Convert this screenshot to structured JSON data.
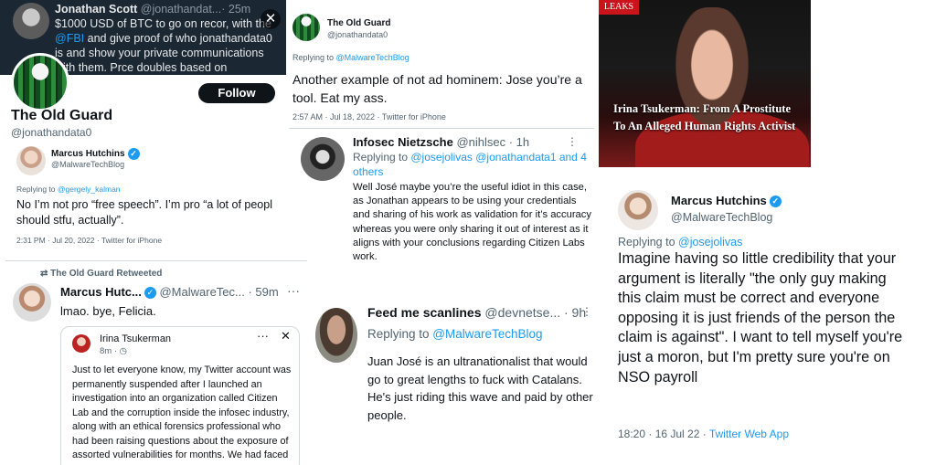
{
  "panel1": {
    "dark_tweet": {
      "author": "Jonathan Scott",
      "handle_time": "@jonathandat...· 25m",
      "text_part1": "$1000 USD of BTC to go on recor, with the ",
      "mention": "@FBI",
      "text_part2": " and give proof of who jonathandata0 is and show your private communications with them. Prce doubles based on information provided.",
      "close_glyph": "✕"
    },
    "profile": {
      "follow_label": "Follow",
      "name": "The Old Guard",
      "handle": "@jonathandata0"
    },
    "reply": {
      "author": "Marcus Hutchins",
      "handle": "@MalwareTechBlog",
      "replying_prefix": "Replying to ",
      "replying_to": "@gergely_kalman",
      "text": "No I’m not pro “free speech”. I’m pro “a lot of peopl should stfu, actually”.",
      "meta": "2:31 PM · Jul 20, 2022 · Twitter for iPhone"
    }
  },
  "panel2": {
    "retweet_label": "The Old Guard Retweeted",
    "author": "Marcus Hutc...",
    "handle_time": "@MalwareTec... · 59m",
    "more_glyph": "···",
    "text": "lmao. bye, Felicia.",
    "quote": {
      "author": "Irina Tsukerman",
      "time": "8m · ◷",
      "dots": "···",
      "close_glyph": "✕",
      "text": "Just to let everyone know, my Twitter account was permanently suspended after I launched an investigation into an organization called Citizen Lab and the corruption inside the infosec industry, along with an ethical forensics professional who had been raising questions about the exposure of assorted vulnerabilities for months. We had faced"
    }
  },
  "panel3": {
    "author": "The Old Guard",
    "handle": "@jonathandata0",
    "replying_prefix": "Replying to ",
    "replying_to": "@MalwareTechBlog",
    "text": "Another example of not ad hominem: Jose you’re a tool. Eat my ass.",
    "meta": "2:57 AM · Jul 18, 2022 · Twitter for iPhone"
  },
  "panel4": {
    "author": "Infosec Nietzsche",
    "handle_time": "@nihlsec · 1h",
    "dots": "⋮",
    "replying_prefix": "Replying to ",
    "replying_to": "@josejolivas @jonathandata1 and 4 others",
    "text": "Well José maybe you’re the useful idiot in this case, as Jonathan appears to be using your credentials and sharing of his work as validation for it’s accuracy whereas you were only sharing it out of interest as it aligns with your conclusions regarding Citizen Labs work."
  },
  "panel5": {
    "author": "Feed me scanlines",
    "handle_time": "@devnetse... · 9h",
    "dots": "⋮",
    "replying_prefix": "Replying to ",
    "replying_to": "@MalwareTechBlog",
    "text": "Juan José is an ultranationalist that would go to great lengths to fuck with Catalans. He's just riding this wave and paid by other people."
  },
  "panel6": {
    "badge": "LEAKS",
    "caption": "Irina Tsukerman: From A Prostitute To An Alleged Human Rights Activist"
  },
  "panel7": {
    "author": "Marcus Hutchins",
    "handle": "@MalwareTechBlog",
    "replying_prefix": "Replying to ",
    "replying_to": "@josejolivas",
    "text": "Imagine having so little credibility that your argument is literally \"the only guy making this claim must be correct and everyone opposing it is just friends of the person the claim is against\". I want to tell myself you're just a moron, but I'm pretty sure you're on NSO payroll",
    "meta_time": "18:20 · 16 Jul 22 · ",
    "meta_app": "Twitter Web App"
  },
  "colors": {
    "link": "#1d9bf0",
    "dark_bg": "#1b2733",
    "leaks_red": "#c9141b"
  }
}
